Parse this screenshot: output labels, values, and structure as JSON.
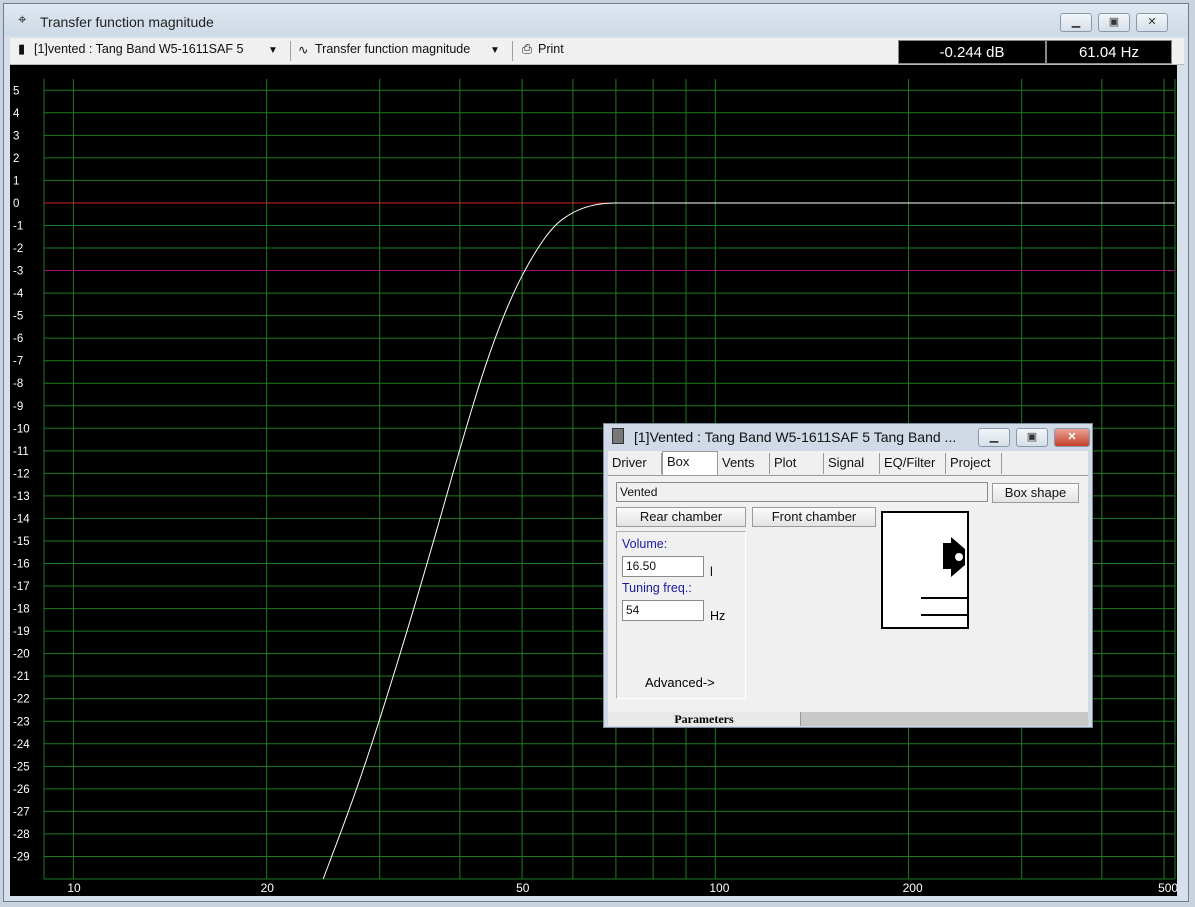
{
  "window": {
    "title": "Transfer function magnitude"
  },
  "toolbar": {
    "project_selector": "[1]vented : Tang Band W5-1611SAF 5",
    "graph_selector": "Transfer function magnitude",
    "print_label": "Print"
  },
  "readouts": {
    "level": "-0.244 dB",
    "frequency": "61.04 Hz"
  },
  "chart_data": {
    "type": "line",
    "x_scale": "log",
    "xlim": [
      9,
      520
    ],
    "ylim": [
      -30,
      5.5
    ],
    "x_tick_labels": [
      "10",
      "20",
      "50",
      "100",
      "200",
      "500"
    ],
    "x_tick_values": [
      10,
      20,
      50,
      100,
      200,
      500
    ],
    "y_tick_values": [
      5,
      4,
      3,
      2,
      1,
      0,
      -1,
      -2,
      -3,
      -4,
      -5,
      -6,
      -7,
      -8,
      -9,
      -10,
      -11,
      -12,
      -13,
      -14,
      -15,
      -16,
      -17,
      -18,
      -19,
      -20,
      -21,
      -22,
      -23,
      -24,
      -25,
      -26,
      -27,
      -28,
      -29
    ],
    "grid": true,
    "reference_lines": [
      {
        "y": 0,
        "color": "#d02020"
      },
      {
        "y": -3,
        "color": "#a01070"
      }
    ],
    "series": [
      {
        "color": "#ffffff",
        "x": [
          24.5,
          28,
          32,
          36,
          40,
          44,
          48,
          52,
          56,
          60,
          64,
          68,
          72,
          80,
          100,
          150,
          200,
          300,
          400,
          520
        ],
        "y": [
          -30,
          -25.6,
          -20.4,
          -15.5,
          -10.9,
          -7.0,
          -4.2,
          -2.3,
          -1.0,
          -0.4,
          -0.1,
          0,
          0,
          0,
          0,
          0,
          0,
          0,
          0,
          0
        ]
      }
    ],
    "axis_bg": "#000000",
    "grid_color": "#1f7a1f"
  },
  "dialog": {
    "title": "[1]Vented : Tang Band W5-1611SAF 5 Tang Band ...",
    "tabs": [
      "Driver",
      "Box",
      "Vents",
      "Plot",
      "Signal",
      "EQ/Filter",
      "Project"
    ],
    "active_tab": "Box",
    "box_type": "Vented",
    "box_shape_button": "Box shape",
    "rear_chamber_button": "Rear chamber",
    "front_chamber_button": "Front chamber",
    "volume_label": "Volume:",
    "volume_value": "16.50",
    "volume_unit": "l",
    "tuning_label": "Tuning freq.:",
    "tuning_value": "54",
    "tuning_unit": "Hz",
    "advanced_link": "Advanced->",
    "status_tab": "Parameters"
  },
  "icons": {
    "window_icon": "crosshair-icon",
    "project_icon": "speaker-icon",
    "graph_icon": "waveform-icon",
    "print_icon": "printer-icon"
  }
}
